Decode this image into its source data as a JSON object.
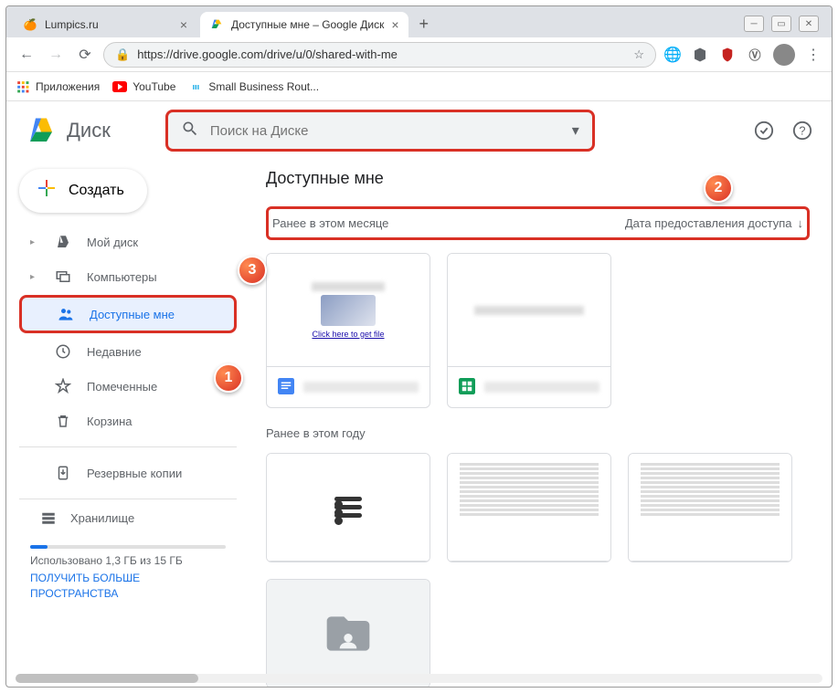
{
  "window": {
    "tabs": [
      {
        "title": "Lumpics.ru"
      },
      {
        "title": "Доступные мне – Google Диск"
      }
    ]
  },
  "address_bar": {
    "url": "https://drive.google.com/drive/u/0/shared-with-me"
  },
  "bookmarks": {
    "apps": "Приложения",
    "youtube": "YouTube",
    "sbr": "Small Business Rout..."
  },
  "header": {
    "logo_text": "Диск",
    "search_placeholder": "Поиск на Диске"
  },
  "sidebar": {
    "create": "Создать",
    "items": {
      "my_drive": "Мой диск",
      "computers": "Компьютеры",
      "shared": "Доступные мне",
      "recent": "Недавние",
      "starred": "Помеченные",
      "trash": "Корзина",
      "backups": "Резервные копии",
      "storage": "Хранилище"
    },
    "storage": {
      "used_text": "Использовано 1,3 ГБ из 15 ГБ",
      "get_more": "ПОЛУЧИТЬ БОЛЬШЕ ПРОСТРАНСТВА"
    }
  },
  "main": {
    "title": "Доступные мне",
    "section_month": "Ранее в этом месяце",
    "sort_label": "Дата предоставления доступа",
    "section_year": "Ранее в этом году",
    "file1_link": "Click here to get file"
  },
  "markers": {
    "m1": "1",
    "m2": "2",
    "m3": "3"
  }
}
